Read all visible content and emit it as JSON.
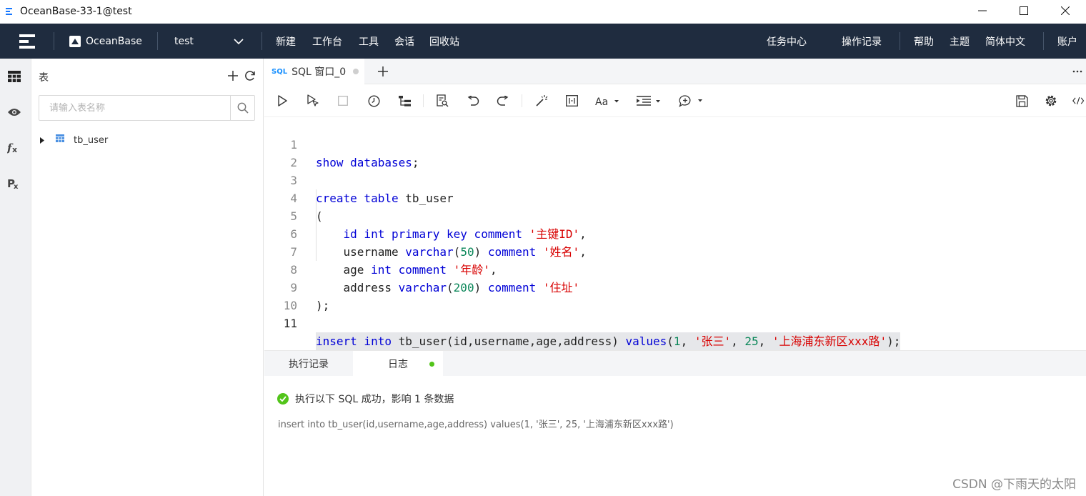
{
  "window": {
    "title": "OceanBase-33-1@test"
  },
  "navbar": {
    "brand": "OceanBase",
    "database": "test",
    "menu": [
      "新建",
      "工作台",
      "工具",
      "会话",
      "回收站"
    ],
    "right": [
      "任务中心",
      "操作记录",
      "帮助",
      "主题",
      "简体中文",
      "账户"
    ],
    "colors": {
      "background": "#1f2c3f"
    }
  },
  "rail": {
    "icons": [
      "table-icon",
      "view-icon",
      "function-icon",
      "procedure-icon"
    ]
  },
  "tablepanel": {
    "title": "表",
    "search_placeholder": "请输入表名称",
    "tables": [
      {
        "name": "tb_user"
      }
    ]
  },
  "editor": {
    "tab_tag": "SQL",
    "tab_label": "SQL 窗口_0",
    "active_line": 11,
    "line_numbers": [
      "1",
      "2",
      "3",
      "4",
      "5",
      "6",
      "7",
      "8",
      "9",
      "10",
      "11"
    ]
  },
  "results": {
    "tabs": [
      "执行记录",
      "日志"
    ],
    "active_tab": "日志",
    "status_message": "执行以下 SQL 成功，影响 1 条数据",
    "sql_text": "insert into tb_user(id,username,age,address) values(1, '张三', 25, '上海浦东新区xxx路')",
    "colors": {
      "success": "#52c41a"
    }
  },
  "watermark": "CSDN @下雨天的太阳"
}
